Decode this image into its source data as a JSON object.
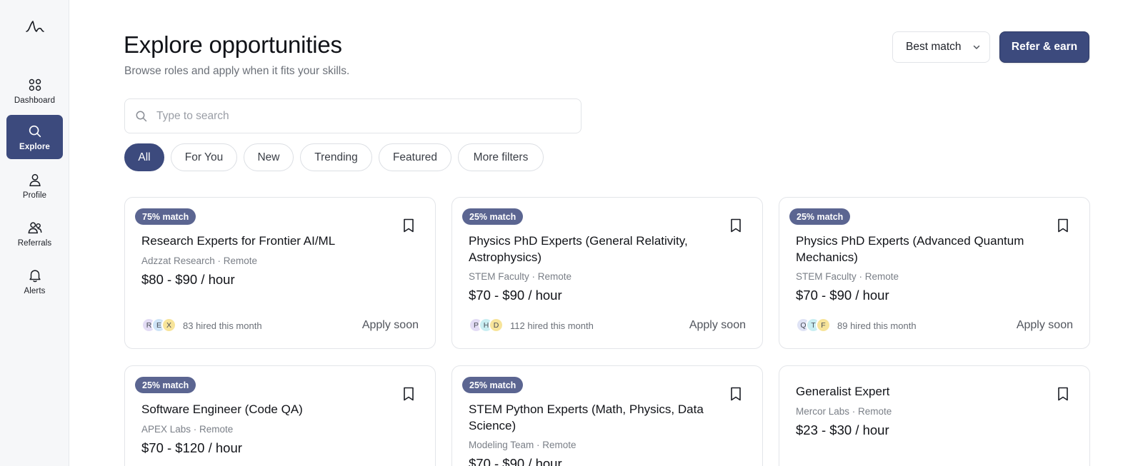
{
  "sidebar": {
    "items": [
      {
        "label": "Dashboard",
        "icon": "grid-icon"
      },
      {
        "label": "Explore",
        "icon": "search-icon",
        "active": true
      },
      {
        "label": "Profile",
        "icon": "user-icon"
      },
      {
        "label": "Referrals",
        "icon": "users-icon"
      },
      {
        "label": "Alerts",
        "icon": "bell-icon"
      }
    ]
  },
  "header": {
    "title": "Explore opportunities",
    "subtitle": "Browse roles and apply when it fits your skills.",
    "sort_value": "Best match",
    "refer_label": "Refer & earn"
  },
  "search": {
    "placeholder": "Type to search",
    "value": ""
  },
  "filters": [
    "All",
    "For You",
    "New",
    "Trending",
    "Featured",
    "More filters"
  ],
  "colors": {
    "accent": "#3c4a7d",
    "badge": "#5b6591"
  },
  "cards": [
    {
      "match": "75% match",
      "title": "Research Experts for Frontier AI/ML",
      "meta": "Adzzat Research · Remote",
      "rate": "$80 - $90 / hour",
      "avatars": [
        "R",
        "E",
        "X"
      ],
      "hired": "83 hired this month",
      "action": "Apply soon"
    },
    {
      "match": "25% match",
      "title": "Physics PhD Experts (General Relativity, Astrophysics)",
      "meta": "STEM Faculty · Remote",
      "rate": "$70 - $90 / hour",
      "avatars": [
        "P",
        "H",
        "D"
      ],
      "hired": "112 hired this month",
      "action": "Apply soon"
    },
    {
      "match": "25% match",
      "title": "Physics PhD Experts (Advanced Quantum Mechanics)",
      "meta": "STEM Faculty · Remote",
      "rate": "$70 - $90 / hour",
      "avatars": [
        "Q",
        "T",
        "F"
      ],
      "hired": "89 hired this month",
      "action": "Apply soon"
    },
    {
      "match": "25% match",
      "title": "Software Engineer (Code QA)",
      "meta": "APEX Labs · Remote",
      "rate": "$70 - $120 / hour"
    },
    {
      "match": "25% match",
      "title": "STEM Python Experts (Math, Physics, Data Science)",
      "meta": "Modeling Team · Remote",
      "rate": "$70 - $90 / hour"
    },
    {
      "title": "Generalist Expert",
      "meta": "Mercor Labs · Remote",
      "rate": "$23 - $30 / hour"
    }
  ]
}
